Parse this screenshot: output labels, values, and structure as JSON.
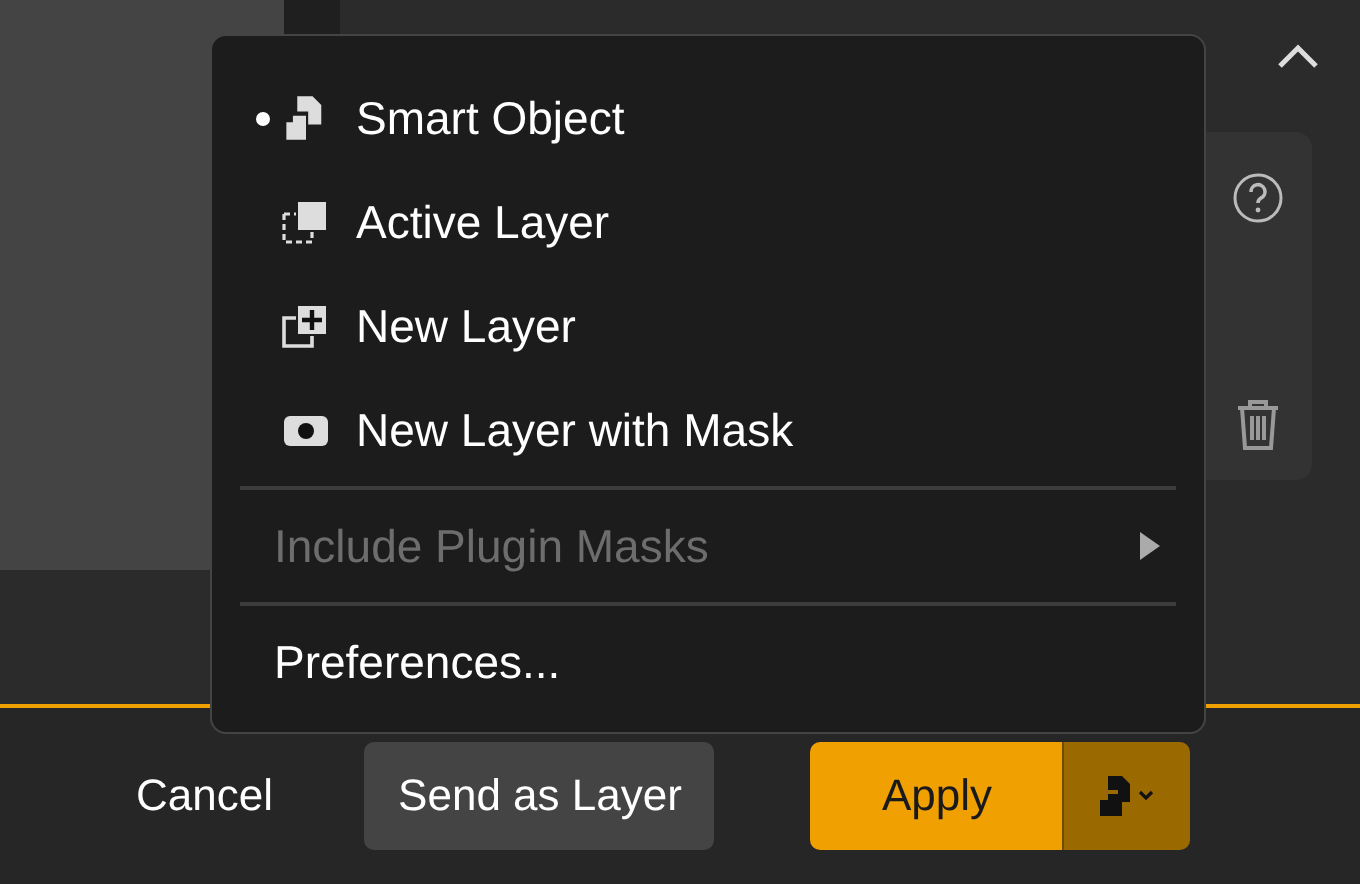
{
  "menu": {
    "options": [
      {
        "label": "Smart Object",
        "selected": true
      },
      {
        "label": "Active Layer",
        "selected": false
      },
      {
        "label": "New Layer",
        "selected": false
      },
      {
        "label": "New Layer with Mask",
        "selected": false
      }
    ],
    "submenu": {
      "label": "Include Plugin Masks",
      "disabled": true
    },
    "preferences": {
      "label": "Preferences..."
    }
  },
  "footer": {
    "cancel": "Cancel",
    "send": "Send as Layer",
    "apply": "Apply"
  }
}
